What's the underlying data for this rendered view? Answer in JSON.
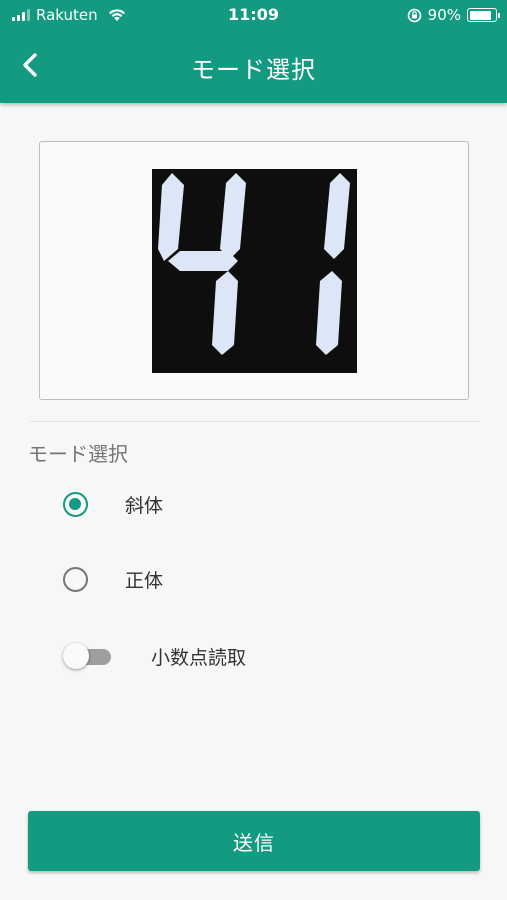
{
  "status_bar": {
    "carrier": "Rakuten",
    "time": "11:09",
    "battery": "90%",
    "battery_level": 0.9
  },
  "header": {
    "back_icon": "chevron-left-icon",
    "title": "モード選択"
  },
  "preview": {
    "display_digits": "41"
  },
  "mode_section": {
    "label": "モード選択",
    "options": [
      {
        "label": "斜体",
        "selected": true
      },
      {
        "label": "正体",
        "selected": false
      }
    ]
  },
  "decimal_toggle": {
    "label": "小数点読取",
    "on": false
  },
  "submit": {
    "label": "送信"
  },
  "colors": {
    "primary": "#139a80",
    "background": "#f7f7f7",
    "lcd_segment": "#dde6f7",
    "lcd_background": "#0e0e0e"
  }
}
